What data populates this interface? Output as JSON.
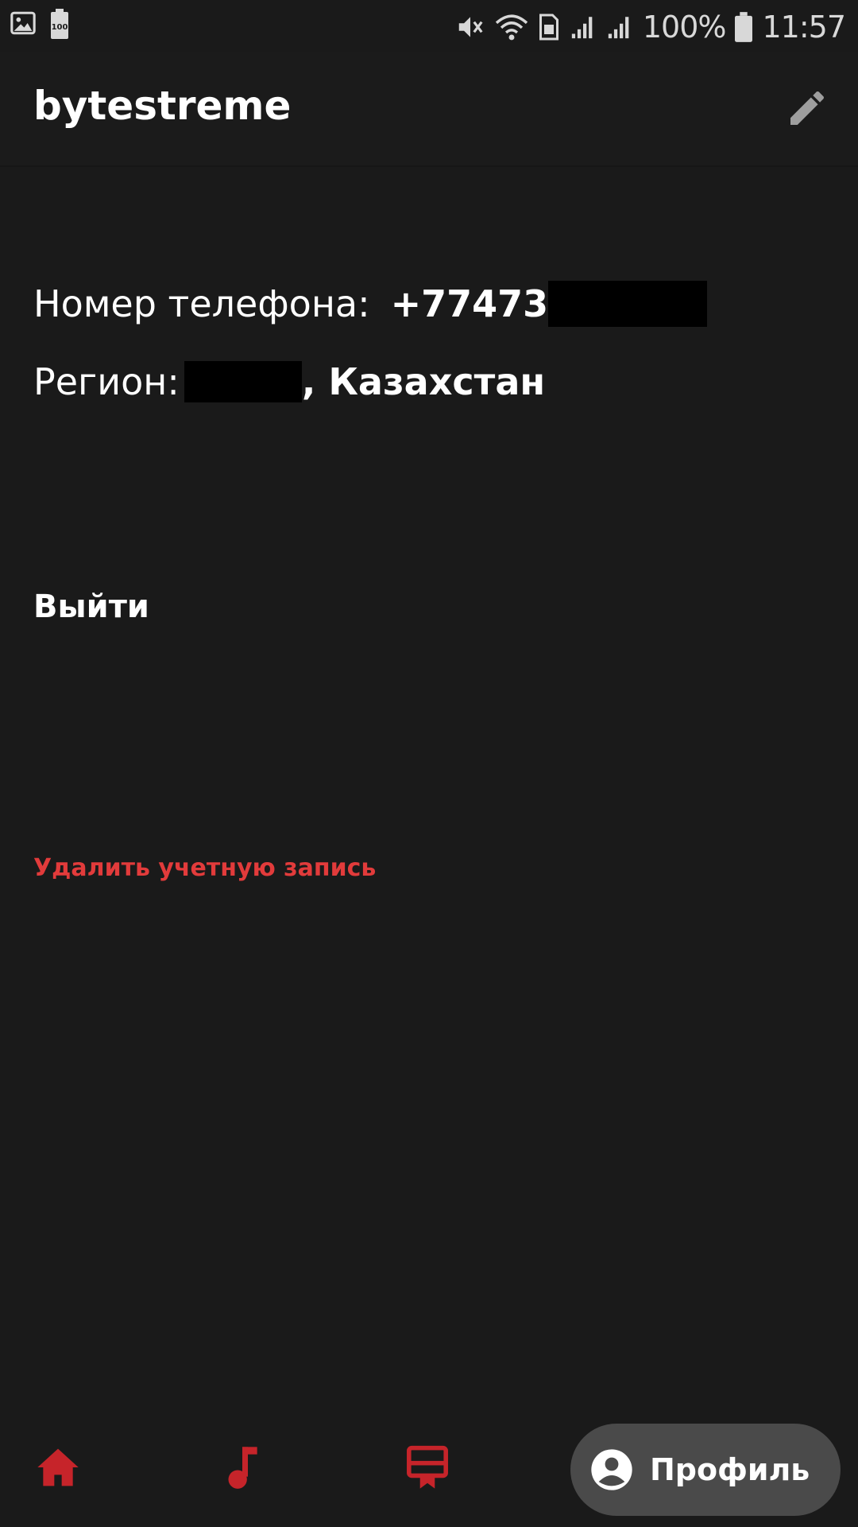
{
  "status_bar": {
    "battery_percent": "100%",
    "time": "11:57",
    "battery_badge": "100",
    "icons": [
      "gallery-icon",
      "battery-saver-icon",
      "mute-icon",
      "wifi-icon",
      "sim-icon",
      "signal-icon",
      "signal-icon",
      "battery-icon"
    ]
  },
  "header": {
    "title": "bytestreme",
    "action_icon": "edit-pencil-icon"
  },
  "profile": {
    "phone_label": "Номер телефона:",
    "phone_value": "+77473",
    "region_label": "Регион:",
    "region_value": ", Казахстан"
  },
  "actions": {
    "logout_label": "Выйти",
    "delete_account_label": "Удалить учетную запись"
  },
  "bottom_nav": {
    "items": [
      {
        "icon": "home-icon"
      },
      {
        "icon": "music-note-icon"
      },
      {
        "icon": "lessons-icon"
      }
    ],
    "active_label": "Профиль",
    "active_icon": "profile-icon"
  },
  "colors": {
    "background": "#1a1a1a",
    "accent_red": "#c6242a",
    "danger_text": "#e23b3b",
    "active_pill": "#4a4a4a"
  }
}
